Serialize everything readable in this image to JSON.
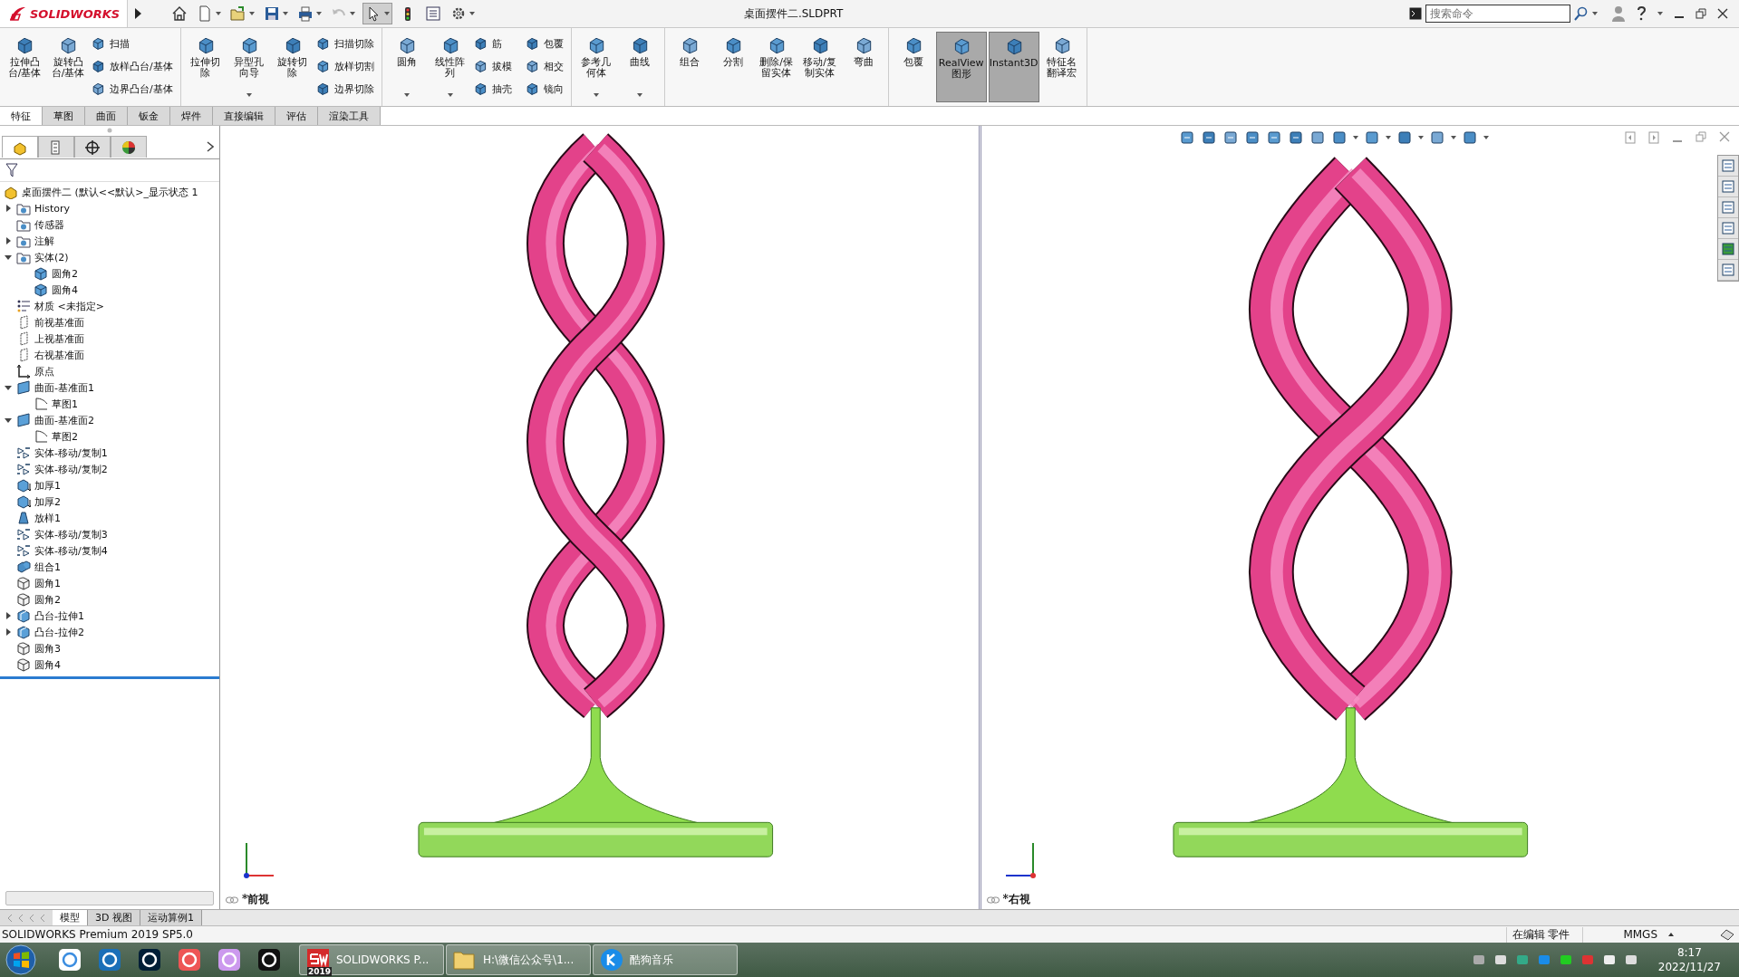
{
  "title_bar": {
    "logo": "SOLIDWORKS",
    "title": "桌面摆件二.SLDPRT",
    "search": {
      "placeholder": "搜索命令"
    }
  },
  "ribbon": {
    "groups": [
      {
        "items": [
          {
            "kind": "large",
            "label": "拉伸凸台/基体",
            "dropdown": false
          },
          {
            "kind": "large",
            "label": "旋转凸台/基体",
            "dropdown": false
          },
          {
            "kind": "stack",
            "items": [
              {
                "label": "扫描"
              },
              {
                "label": "放样凸台/基体"
              },
              {
                "label": "边界凸台/基体"
              }
            ]
          }
        ]
      },
      {
        "items": [
          {
            "kind": "large",
            "label": "拉伸切除",
            "dropdown": false
          },
          {
            "kind": "large",
            "label": "异型孔向导",
            "dropdown": true
          },
          {
            "kind": "large",
            "label": "旋转切除",
            "dropdown": false
          },
          {
            "kind": "stack",
            "items": [
              {
                "label": "扫描切除"
              },
              {
                "label": "放样切割"
              },
              {
                "label": "边界切除"
              }
            ]
          }
        ]
      },
      {
        "items": [
          {
            "kind": "large",
            "label": "圆角",
            "dropdown": true
          },
          {
            "kind": "large",
            "label": "线性阵列",
            "dropdown": true
          },
          {
            "kind": "stack",
            "items": [
              {
                "label": "筋"
              },
              {
                "label": "拔模"
              },
              {
                "label": "抽壳"
              }
            ]
          },
          {
            "kind": "stack",
            "items": [
              {
                "label": "包覆"
              },
              {
                "label": "相交"
              },
              {
                "label": "镜向"
              }
            ]
          }
        ]
      },
      {
        "items": [
          {
            "kind": "large",
            "label": "参考几何体",
            "dropdown": true
          },
          {
            "kind": "large",
            "label": "曲线",
            "dropdown": true
          }
        ]
      },
      {
        "items": [
          {
            "kind": "large",
            "label": "组合",
            "dropdown": false
          },
          {
            "kind": "large",
            "label": "分割",
            "dropdown": false
          },
          {
            "kind": "large",
            "label": "删除/保留实体",
            "dropdown": false
          },
          {
            "kind": "large",
            "label": "移动/复制实体",
            "dropdown": false
          },
          {
            "kind": "large",
            "label": "弯曲",
            "dropdown": false
          }
        ]
      },
      {
        "items": [
          {
            "kind": "large",
            "label": "包覆",
            "dropdown": false
          },
          {
            "kind": "toggle",
            "label": "RealView图形",
            "on": true
          },
          {
            "kind": "toggle",
            "label": "Instant3D",
            "on": true
          },
          {
            "kind": "large",
            "label": "特征名翻译宏",
            "dropdown": false
          }
        ]
      }
    ]
  },
  "command_tabs": [
    {
      "label": "特征",
      "selected": true
    },
    {
      "label": "草图",
      "selected": false
    },
    {
      "label": "曲面",
      "selected": false
    },
    {
      "label": "钣金",
      "selected": false
    },
    {
      "label": "焊件",
      "selected": false
    },
    {
      "label": "直接编辑",
      "selected": false
    },
    {
      "label": "评估",
      "selected": false
    },
    {
      "label": "渲染工具",
      "selected": false
    }
  ],
  "panel_tabs": [
    {
      "kind": "feature-tree",
      "selected": true
    },
    {
      "kind": "property",
      "selected": false
    },
    {
      "kind": "config",
      "selected": false
    },
    {
      "kind": "display",
      "selected": false
    }
  ],
  "tree": {
    "root": "桌面摆件二  (默认<<默认>_显示状态 1",
    "items": [
      {
        "label": "History",
        "kind": "folder",
        "expanded": false
      },
      {
        "label": "传感器",
        "kind": "folder"
      },
      {
        "label": "注解",
        "kind": "folder",
        "expanded": false
      },
      {
        "label": "实体(2)",
        "kind": "folder",
        "expanded": true,
        "children": [
          {
            "label": "圆角2",
            "kind": "body"
          },
          {
            "label": "圆角4",
            "kind": "body"
          }
        ]
      },
      {
        "label": "材质 <未指定>",
        "kind": "material"
      },
      {
        "label": "前视基准面",
        "kind": "plane"
      },
      {
        "label": "上视基准面",
        "kind": "plane"
      },
      {
        "label": "右视基准面",
        "kind": "plane"
      },
      {
        "label": "原点",
        "kind": "origin"
      },
      {
        "label": "曲面-基准面1",
        "kind": "surface",
        "expanded": true,
        "children": [
          {
            "label": "草图1",
            "kind": "sketch"
          }
        ]
      },
      {
        "label": "曲面-基准面2",
        "kind": "surface",
        "expanded": true,
        "children": [
          {
            "label": "草图2",
            "kind": "sketch"
          }
        ]
      },
      {
        "label": "实体-移动/复制1",
        "kind": "move"
      },
      {
        "label": "实体-移动/复制2",
        "kind": "move"
      },
      {
        "label": "加厚1",
        "kind": "thicken"
      },
      {
        "label": "加厚2",
        "kind": "thicken"
      },
      {
        "label": "放样1",
        "kind": "loft"
      },
      {
        "label": "实体-移动/复制3",
        "kind": "move"
      },
      {
        "label": "实体-移动/复制4",
        "kind": "move"
      },
      {
        "label": "组合1",
        "kind": "combine"
      },
      {
        "label": "圆角1",
        "kind": "fillet"
      },
      {
        "label": "圆角2",
        "kind": "fillet"
      },
      {
        "label": "凸台-拉伸1",
        "kind": "extrude",
        "expanded": false
      },
      {
        "label": "凸台-拉伸2",
        "kind": "extrude",
        "expanded": false
      },
      {
        "label": "圆角3",
        "kind": "fillet"
      },
      {
        "label": "圆角4",
        "kind": "fillet"
      }
    ]
  },
  "viewports": [
    {
      "label": "*前視",
      "kind": "front"
    },
    {
      "label": "*右視",
      "kind": "right"
    }
  ],
  "bottom_tabs": [
    {
      "label": "模型",
      "selected": true
    },
    {
      "label": "3D 视图",
      "selected": false
    },
    {
      "label": "运动算例1",
      "selected": false
    }
  ],
  "status_bar": {
    "product": "SOLIDWORKS Premium 2019 SP5.0",
    "mode": "在编辑 零件",
    "units": "MMGS"
  },
  "taskbar": {
    "tasks": [
      {
        "label": "SOLIDWORKS P...",
        "kind": "sw",
        "badge": "2019"
      },
      {
        "label": "H:\\微信公众号\\1...",
        "kind": "folder"
      },
      {
        "label": "酷狗音乐",
        "kind": "music"
      }
    ],
    "time": "8:17",
    "date": "2022/11/27"
  }
}
